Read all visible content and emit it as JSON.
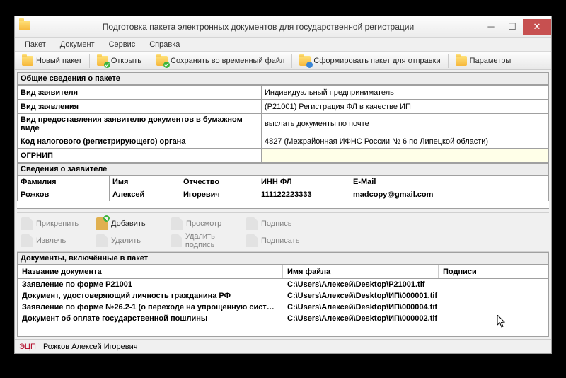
{
  "title": "Подготовка пакета электронных документов для государственной регистрации",
  "menu": {
    "package": "Пакет",
    "document": "Документ",
    "service": "Сервис",
    "help": "Справка"
  },
  "toolbar": {
    "new_package": "Новый пакет",
    "open": "Открыть",
    "save_temp": "Сохранить во временный файл",
    "form_package": "Сформировать пакет для отправки",
    "params": "Параметры"
  },
  "sections": {
    "general": "Общие сведения о пакете",
    "applicant": "Сведения о заявителе",
    "documents_included": "Документы, включённые в пакет"
  },
  "general": {
    "applicant_type_label": "Вид заявителя",
    "applicant_type_value": "Индивидуальный предприниматель",
    "application_type_label": "Вид заявления",
    "application_type_value": "(P21001) Регистрация ФЛ в качестве ИП",
    "paper_delivery_label": "Вид предоставления заявителю документов в бумажном виде",
    "paper_delivery_value": "выслать документы по почте",
    "tax_code_label": "Код налогового (регистрирующего) органа",
    "tax_code_value": "4827 (Межрайонная ИФНС России № 6 по Липецкой области)",
    "ogrnip_label": "ОГРНИП",
    "ogrnip_value": ""
  },
  "applicant_cols": {
    "surname": "Фамилия",
    "name": "Имя",
    "patronymic": "Отчество",
    "inn": "ИНН ФЛ",
    "email": "E-Mail"
  },
  "applicant_row": {
    "surname": "Рожков",
    "name": "Алексей",
    "patronymic": "Игоревич",
    "inn": "111122223333",
    "email": "madcopy@gmail.com"
  },
  "actions": {
    "attach": "Прикрепить",
    "add": "Добавить",
    "view": "Просмотр",
    "signature": "Подпись",
    "extract": "Извлечь",
    "delete": "Удалить",
    "delete_signature": "Удалить подпись",
    "sign": "Подписать"
  },
  "docs_cols": {
    "name": "Название документа",
    "file": "Имя файла",
    "signatures": "Подписи"
  },
  "docs": [
    {
      "name": "Заявление по форме Р21001",
      "file": "C:\\Users\\Алексей\\Desktop\\P21001.tif"
    },
    {
      "name": "Документ, удостоверяющий личность гражданина РФ",
      "file": "C:\\Users\\Алексей\\Desktop\\ИП\\000001.tif"
    },
    {
      "name": "Заявление по форме №26.2-1 (о переходе на упрощенную сист…",
      "file": "C:\\Users\\Алексей\\Desktop\\ИП\\000004.tif"
    },
    {
      "name": "Документ об оплате государственной пошлины",
      "file": "C:\\Users\\Алексей\\Desktop\\ИП\\000002.tif"
    }
  ],
  "status": {
    "ecp": "ЭЦП",
    "signer": "Рожков Алексей Игоревич"
  }
}
